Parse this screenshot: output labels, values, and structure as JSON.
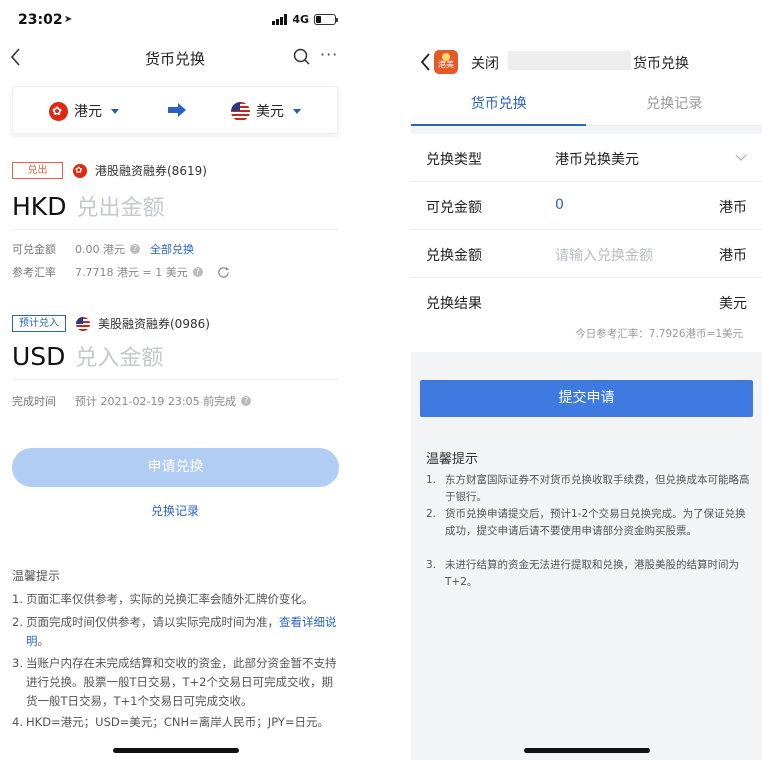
{
  "left": {
    "status": {
      "time": "23:02",
      "network": "4G"
    },
    "nav": {
      "title": "货币兑换"
    },
    "currency": {
      "from": "港元",
      "to": "美元"
    },
    "out_section": {
      "tag": "兑出",
      "account": "港股融资融券(8619)",
      "code": "HKD",
      "placeholder": "兑出金额",
      "available_label": "可兑金额",
      "available_value": "0.00 港元",
      "exchange_all": "全部兑换",
      "rate_label": "参考汇率",
      "rate_value": "7.7718 港元 = 1 美元"
    },
    "in_section": {
      "tag": "预计兑入",
      "account": "美股融资融券(0986)",
      "code": "USD",
      "placeholder": "兑入金额",
      "time_label": "完成时间",
      "time_value": "预计 2021-02-19 23:05 前完成"
    },
    "apply_label": "申请兑换",
    "history_link": "兑换记录",
    "tips": {
      "title": "温馨提示",
      "items": [
        {
          "n": "1.",
          "text": "页面汇率仅供参考，实际的兑换汇率会随外汇牌价变化。"
        },
        {
          "n": "2.",
          "text": "页面完成时间仅供参考，请以实际完成时间为准，",
          "link": "查看详细说明",
          "suffix": "。"
        },
        {
          "n": "3.",
          "text": "当账户内存在未完成结算和交收的资金，此部分资金暂不支持进行兑换。股票一般T日交易，T+2个交易日可完成交收，期货一般T日交易，T+1个交易日可完成交收。"
        },
        {
          "n": "4.",
          "text": "HKD=港元；USD=美元；CNH=离岸人民币；JPY=日元。"
        }
      ]
    }
  },
  "right": {
    "header": {
      "close": "关闭",
      "logo_text": "港美",
      "title": "货币兑换"
    },
    "tabs": [
      {
        "label": "货币兑换",
        "active": true
      },
      {
        "label": "兑换记录",
        "active": false
      }
    ],
    "form": [
      {
        "label": "兑换类型",
        "value": "港币兑换美元",
        "unit": ""
      },
      {
        "label": "可兑金额",
        "value": "0",
        "unit": "港币"
      },
      {
        "label": "兑换金额",
        "value": "请输入兑换金额",
        "unit": "港币"
      },
      {
        "label": "兑换结果",
        "value": "",
        "unit": "美元"
      }
    ],
    "rate_note": "今日参考汇率：7.7926港币=1美元",
    "submit_label": "提交申请",
    "tips": {
      "title": "温馨提示",
      "items": [
        {
          "n": "1.",
          "text": "东方财富国际证券不对货币兑换收取手续费，但兑换成本可能略高于银行。"
        },
        {
          "n": "2.",
          "text": "货币兑换申请提交后，预计1-2个交易日兑换完成。为了保证兑换成功，提交申请后请不要使用申请部分资金购买股票。"
        },
        {
          "n": "3.",
          "text": "未进行结算的资金无法进行提取和兑换，港股美股的结算时间为T+2。"
        }
      ]
    }
  },
  "colors": {
    "accent": "#2a63c7",
    "button_disabled": "#b2cdf3",
    "button_primary": "#3f7ae0",
    "out_tag": "#e5663e"
  }
}
